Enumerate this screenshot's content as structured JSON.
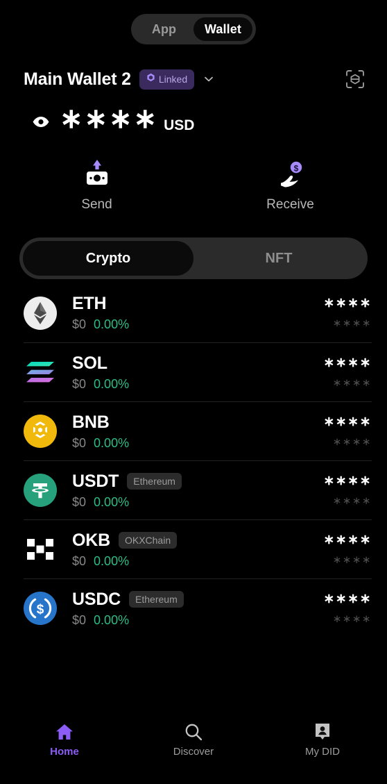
{
  "top_toggle": {
    "options": [
      {
        "label": "App",
        "active": false
      },
      {
        "label": "Wallet",
        "active": true
      }
    ]
  },
  "wallet": {
    "name": "Main Wallet 2",
    "badge_label": "Linked",
    "badge_icon": "hexagon-icon",
    "dropdown_icon": "chevron-down-icon",
    "scan_icon": "scan-code-icon",
    "accent_purple": "#8B5CF6",
    "badge_bg": "#3A2A5E",
    "badge_text_color": "#BCA6E8"
  },
  "balance": {
    "eye_icon": "eye-icon",
    "masked_value": "∗∗∗∗",
    "currency": "USD"
  },
  "actions": [
    {
      "label": "Send",
      "icon": "send-money-icon"
    },
    {
      "label": "Receive",
      "icon": "receive-money-icon"
    }
  ],
  "asset_tabs": {
    "options": [
      {
        "label": "Crypto",
        "active": true
      },
      {
        "label": "NFT",
        "active": false
      }
    ]
  },
  "tokens": [
    {
      "symbol": "ETH",
      "chain": "",
      "price": "$0",
      "change": "0.00%",
      "amount": "∗∗∗∗",
      "value": "∗∗∗∗",
      "icon": "ethereum-icon",
      "color": "#E8E8E8"
    },
    {
      "symbol": "SOL",
      "chain": "",
      "price": "$0",
      "change": "0.00%",
      "amount": "∗∗∗∗",
      "value": "∗∗∗∗",
      "icon": "solana-icon",
      "color": "#14F195"
    },
    {
      "symbol": "BNB",
      "chain": "",
      "price": "$0",
      "change": "0.00%",
      "amount": "∗∗∗∗",
      "value": "∗∗∗∗",
      "icon": "bnb-icon",
      "color": "#F0B90B"
    },
    {
      "symbol": "USDT",
      "chain": "Ethereum",
      "price": "$0",
      "change": "0.00%",
      "amount": "∗∗∗∗",
      "value": "∗∗∗∗",
      "icon": "tether-icon",
      "color": "#26A17B"
    },
    {
      "symbol": "OKB",
      "chain": "OKXChain",
      "price": "$0",
      "change": "0.00%",
      "amount": "∗∗∗∗",
      "value": "∗∗∗∗",
      "icon": "okb-icon",
      "color": "#FFFFFF"
    },
    {
      "symbol": "USDC",
      "chain": "Ethereum",
      "price": "$0",
      "change": "0.00%",
      "amount": "∗∗∗∗",
      "value": "∗∗∗∗",
      "icon": "usdc-icon",
      "color": "#2775CA"
    }
  ],
  "bottom_nav": [
    {
      "label": "Home",
      "icon": "home-icon",
      "active": true
    },
    {
      "label": "Discover",
      "icon": "search-icon",
      "active": false
    },
    {
      "label": "My DID",
      "icon": "id-badge-icon",
      "active": false
    }
  ],
  "colors": {
    "background": "#000000",
    "positive_green": "#2EBD85",
    "muted_gray": "#888888",
    "accent": "#8B5CF6"
  }
}
